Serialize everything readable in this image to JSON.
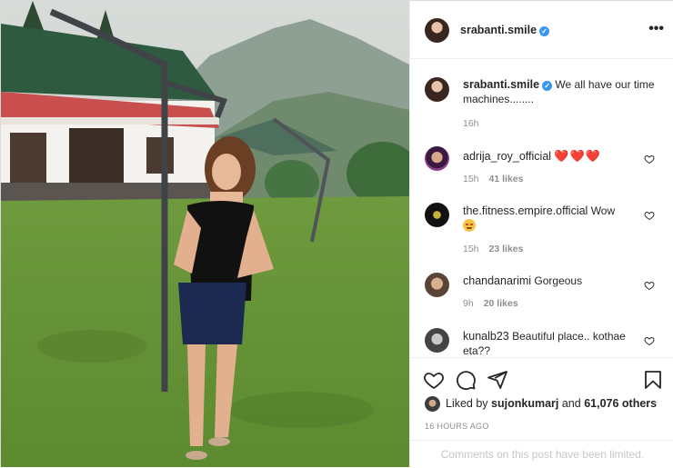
{
  "post": {
    "owner": "srabanti.smile",
    "caption": "We all have our time machines........",
    "caption_age": "16h"
  },
  "comments": [
    {
      "user": "adrija_roy_official",
      "text": "❤️❤️❤️",
      "age": "15h",
      "likes": "41 likes"
    },
    {
      "user": "the.fitness.empire.official",
      "text": "Wow",
      "emoji": "🤩",
      "age": "15h",
      "likes": "23 likes"
    },
    {
      "user": "chandanarimi",
      "text": "Gorgeous",
      "age": "9h",
      "likes": "20 likes"
    },
    {
      "user": "kunalb23",
      "text": "Beautiful place.. kothae eta??"
    }
  ],
  "likes": {
    "prefix": "Liked by",
    "user": "sujonkumarj",
    "middle": "and",
    "others": "61,076 others"
  },
  "timestamp": "16 HOURS AGO",
  "limited_notice": "Comments on this post have been limited.",
  "icons": {
    "like": "heart-icon",
    "comment": "comment-bubble-icon",
    "share": "paper-plane-icon",
    "save": "bookmark-icon",
    "more": "more-options-icon",
    "verified": "verified-badge-icon"
  },
  "colors": {
    "verified": "#3897f0",
    "heart": "#ed1c24",
    "muted": "#8e8e8e"
  }
}
